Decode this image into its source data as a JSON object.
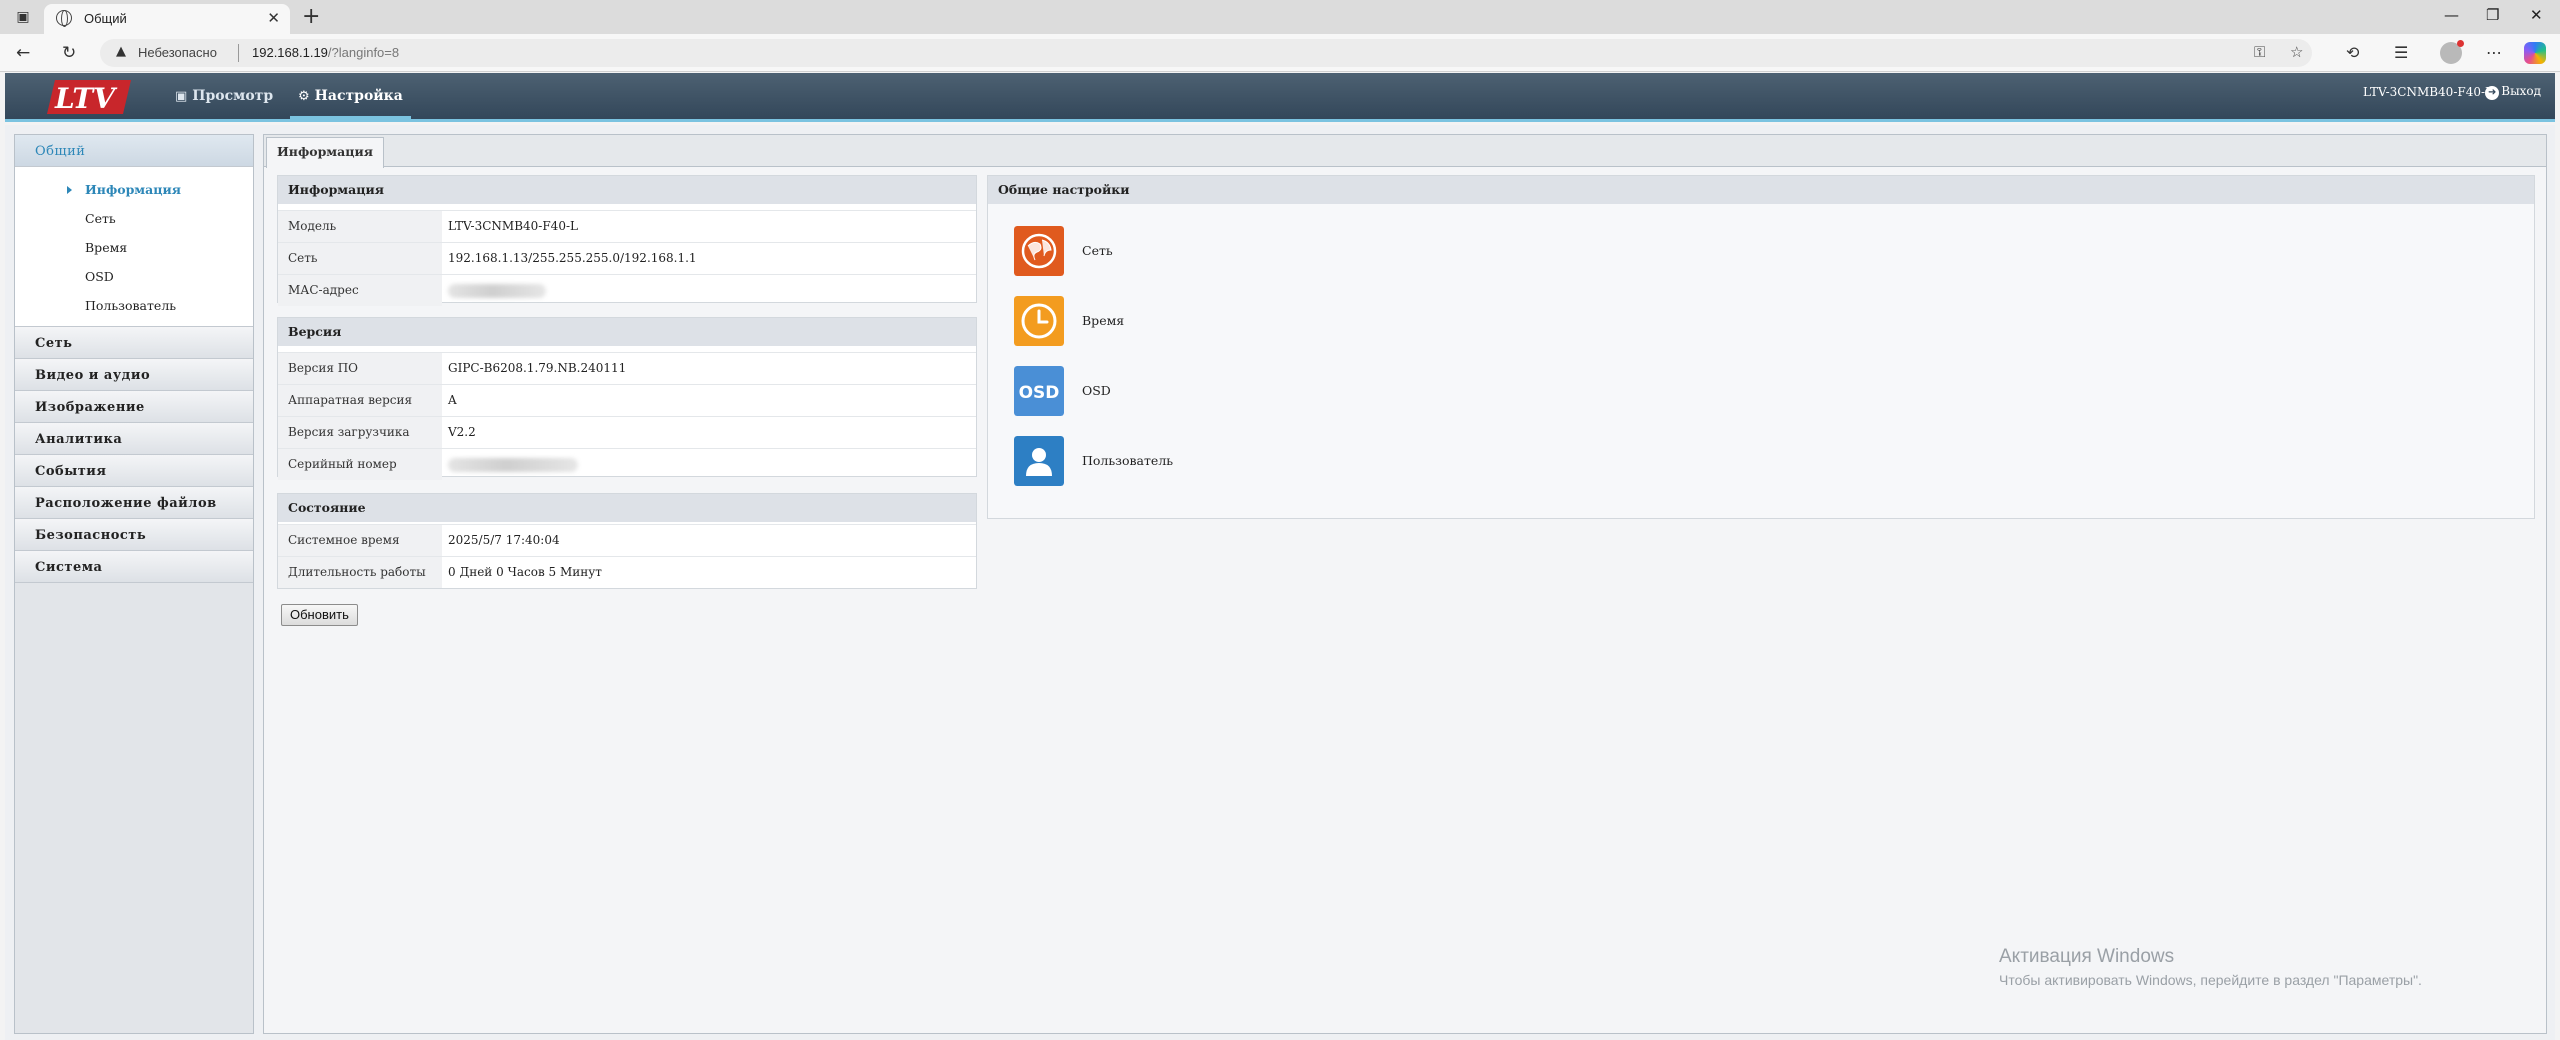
{
  "browser": {
    "tab_title": "Общий",
    "insecure_label": "Небезопасно",
    "url_host": "192.168.1.19",
    "url_path": "/?langinfo=8"
  },
  "header": {
    "logo_text": "LTV",
    "nav": [
      {
        "label": "Просмотр",
        "icon": "monitor-icon"
      },
      {
        "label": "Настройка",
        "icon": "gear-icon"
      }
    ],
    "device_name": "LTV-3CNMB40-F40-L",
    "logout_label": "Выход"
  },
  "sidebar": {
    "groups": [
      {
        "label": "Общий",
        "open": true
      },
      {
        "label": "Сеть"
      },
      {
        "label": "Видео и аудио"
      },
      {
        "label": "Изображение"
      },
      {
        "label": "Аналитика"
      },
      {
        "label": "События"
      },
      {
        "label": "Расположение файлов"
      },
      {
        "label": "Безопасность"
      },
      {
        "label": "Система"
      }
    ],
    "sub_items": [
      {
        "label": "Информация",
        "active": true
      },
      {
        "label": "Сеть"
      },
      {
        "label": "Время"
      },
      {
        "label": "OSD"
      },
      {
        "label": "Пользователь"
      }
    ]
  },
  "content": {
    "tab_label": "Информация",
    "info": {
      "title": "Информация",
      "rows": [
        {
          "key": "Модель",
          "value": "LTV-3CNMB40-F40-L"
        },
        {
          "key": "Сеть",
          "value": "192.168.1.13/255.255.255.0/192.168.1.1"
        },
        {
          "key": "МАС-адрес",
          "value": ""
        }
      ]
    },
    "version": {
      "title": "Версия",
      "rows": [
        {
          "key": "Версия ПО",
          "value": "GIPC-B6208.1.79.NB.240111"
        },
        {
          "key": "Аппаратная версия",
          "value": "A"
        },
        {
          "key": "Версия загрузчика",
          "value": "V2.2"
        },
        {
          "key": "Серийный номер",
          "value": ""
        }
      ]
    },
    "status": {
      "title": "Состояние",
      "rows": [
        {
          "key": "Системное время",
          "value": "2025/5/7 17:40:04"
        },
        {
          "key": "Длительность работы",
          "value": "0 Дней 0 Часов 5 Минут"
        }
      ]
    },
    "refresh_label": "Обновить",
    "general": {
      "title": "Общие настройки",
      "items": [
        {
          "label": "Сеть",
          "icon": "network-globe-icon",
          "color": "#e05a1e"
        },
        {
          "label": "Время",
          "icon": "clock-icon",
          "color": "#f39c1f"
        },
        {
          "label": "OSD",
          "icon": "osd-icon",
          "color": "#4a8fd6",
          "icon_text": "OSD"
        },
        {
          "label": "Пользователь",
          "icon": "user-icon",
          "color": "#2d7fc4"
        }
      ]
    }
  },
  "watermark": {
    "line1": "Активация Windows",
    "line2": "Чтобы активировать Windows, перейдите в раздел \"Параметры\"."
  }
}
